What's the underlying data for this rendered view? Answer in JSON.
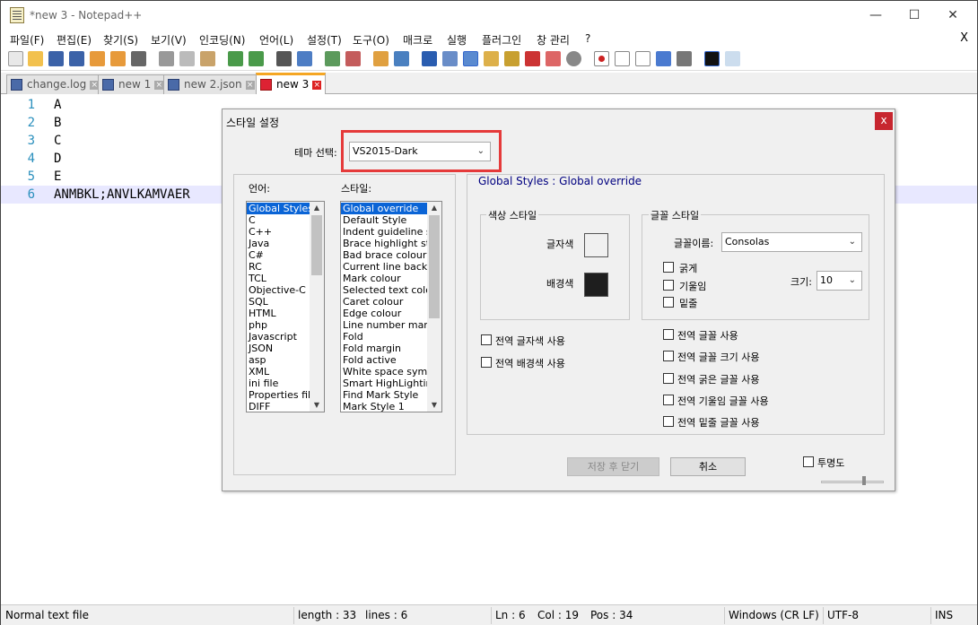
{
  "window": {
    "title": "*new 3 - Notepad++",
    "close_menu": "X"
  },
  "menu": [
    "파일(F)",
    "편집(E)",
    "찾기(S)",
    "보기(V)",
    "인코딩(N)",
    "언어(L)",
    "설정(T)",
    "도구(O)",
    "매크로",
    "실행",
    "플러그인",
    "창 관리",
    "?"
  ],
  "tabs": [
    {
      "label": "change.log"
    },
    {
      "label": "new 1"
    },
    {
      "label": "new 2.json"
    },
    {
      "label": "new 3"
    }
  ],
  "editor": {
    "lines": [
      "A",
      "B",
      "C",
      "D",
      "E",
      "ANMBKL;ANVLKAMVAER"
    ],
    "line_numbers": [
      "1",
      "2",
      "3",
      "4",
      "5",
      "6"
    ]
  },
  "status": {
    "type": "Normal text file",
    "length": "length : 33",
    "lines": "lines : 6",
    "ln": "Ln : 6",
    "col": "Col : 19",
    "pos": "Pos : 34",
    "eol": "Windows (CR LF)",
    "encoding": "UTF-8",
    "mode": "INS"
  },
  "dialog": {
    "title": "스타일 설정",
    "close": "x",
    "theme_label": "테마 선택:",
    "theme_value": "VS2015-Dark",
    "language_label": "언어:",
    "style_label": "스타일:",
    "languages": [
      "Global Styles",
      "C",
      "C++",
      "Java",
      "C#",
      "RC",
      "TCL",
      "Objective-C",
      "SQL",
      "HTML",
      "php",
      "Javascript",
      "JSON",
      "asp",
      "XML",
      "ini file",
      "Properties file",
      "DIFF"
    ],
    "styles": [
      "Global override",
      "Default Style",
      "Indent guideline style",
      "Brace highlight style",
      "Bad brace colour",
      "Current line background",
      "Mark colour",
      "Selected text colour",
      "Caret colour",
      "Edge colour",
      "Line number margin",
      "Fold",
      "Fold margin",
      "Fold active",
      "White space symbol",
      "Smart HighLighting",
      "Find Mark Style",
      "Mark Style 1"
    ],
    "section_title": "Global Styles : Global override",
    "color_group": "색상 스타일",
    "fg_label": "글자색",
    "bg_label": "배경색",
    "fg_color": "#f0f0f0",
    "bg_color": "#1e1e1e",
    "font_group": "글꼴 스타일",
    "font_name_label": "글꼴이름:",
    "font_name": "Consolas",
    "bold": "굵게",
    "italic": "기울임",
    "underline": "밑줄",
    "size_label": "크기:",
    "size_value": "10",
    "global_fg": "전역 글자색 사용",
    "global_bg": "전역 배경색 사용",
    "global_font": "전역 글꼴 사용",
    "global_font_size": "전역 글꼴 크기 사용",
    "global_bold": "전역 굵은 글꼴 사용",
    "global_italic": "전역 기울임 글꼴 사용",
    "global_underline": "전역 밑줄 글꼴 사용",
    "save_close": "저장 후 닫기",
    "cancel": "취소",
    "transparency": "투명도"
  },
  "colors": {
    "highlight": "#e53a3a",
    "line_number": "#2a8fbd",
    "selection": "#0a64d6"
  }
}
